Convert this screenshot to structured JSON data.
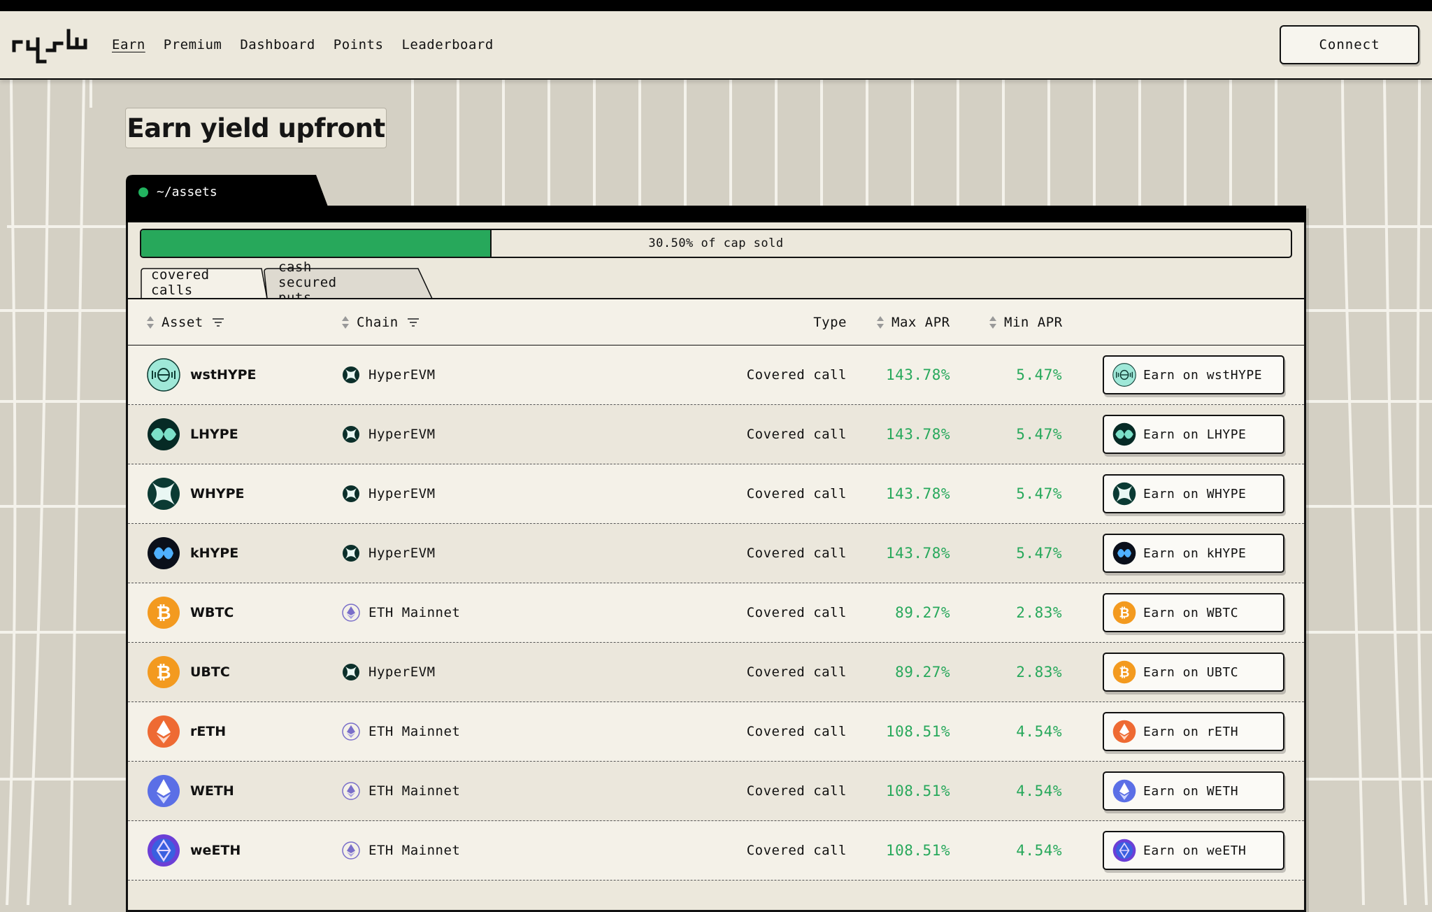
{
  "nav": {
    "links": [
      "Earn",
      "Premium",
      "Dashboard",
      "Points",
      "Leaderboard"
    ],
    "active": "Earn",
    "connect_label": "Connect"
  },
  "page": {
    "title": "Earn yield upfront",
    "panel_tab_label": "~/assets"
  },
  "progress": {
    "fraction": 0.305,
    "label": "30.50% of cap sold",
    "color": "#27a85b"
  },
  "subtabs": [
    "covered calls",
    "cash secured puts"
  ],
  "table": {
    "headers": {
      "asset": "Asset",
      "chain": "Chain",
      "type": "Type",
      "max_apr": "Max APR",
      "min_apr": "Min APR"
    },
    "rows": [
      {
        "asset": "wstHYPE",
        "icon": "wsthype-icon",
        "chain": "HyperEVM",
        "chain_icon": "hyperevm-icon",
        "type": "Covered call",
        "max_apr": "143.78%",
        "min_apr": "5.47%",
        "button": "Earn on wstHYPE"
      },
      {
        "asset": "LHYPE",
        "icon": "lhype-icon",
        "chain": "HyperEVM",
        "chain_icon": "hyperevm-icon",
        "type": "Covered call",
        "max_apr": "143.78%",
        "min_apr": "5.47%",
        "button": "Earn on LHYPE"
      },
      {
        "asset": "WHYPE",
        "icon": "whype-icon",
        "chain": "HyperEVM",
        "chain_icon": "hyperevm-icon",
        "type": "Covered call",
        "max_apr": "143.78%",
        "min_apr": "5.47%",
        "button": "Earn on WHYPE"
      },
      {
        "asset": "kHYPE",
        "icon": "khype-icon",
        "chain": "HyperEVM",
        "chain_icon": "hyperevm-icon",
        "type": "Covered call",
        "max_apr": "143.78%",
        "min_apr": "5.47%",
        "button": "Earn on kHYPE"
      },
      {
        "asset": "WBTC",
        "icon": "bitcoin-icon",
        "chain": "ETH Mainnet",
        "chain_icon": "ethereum-icon",
        "type": "Covered call",
        "max_apr": "89.27%",
        "min_apr": "2.83%",
        "button": "Earn on WBTC"
      },
      {
        "asset": "UBTC",
        "icon": "bitcoin-icon",
        "chain": "HyperEVM",
        "chain_icon": "hyperevm-icon",
        "type": "Covered call",
        "max_apr": "89.27%",
        "min_apr": "2.83%",
        "button": "Earn on UBTC"
      },
      {
        "asset": "rETH",
        "icon": "reth-icon",
        "chain": "ETH Mainnet",
        "chain_icon": "ethereum-icon",
        "type": "Covered call",
        "max_apr": "108.51%",
        "min_apr": "4.54%",
        "button": "Earn on rETH"
      },
      {
        "asset": "WETH",
        "icon": "weth-icon",
        "chain": "ETH Mainnet",
        "chain_icon": "ethereum-icon",
        "type": "Covered call",
        "max_apr": "108.51%",
        "min_apr": "4.54%",
        "button": "Earn on WETH"
      },
      {
        "asset": "weETH",
        "icon": "weeth-icon",
        "chain": "ETH Mainnet",
        "chain_icon": "ethereum-icon",
        "type": "Covered call",
        "max_apr": "108.51%",
        "min_apr": "4.54%",
        "button": "Earn on weETH"
      }
    ]
  },
  "colors": {
    "background": "#d4d0c4",
    "panel": "#ece8dc",
    "accent_green": "#27a85b",
    "status_dot": "#22b35f"
  }
}
